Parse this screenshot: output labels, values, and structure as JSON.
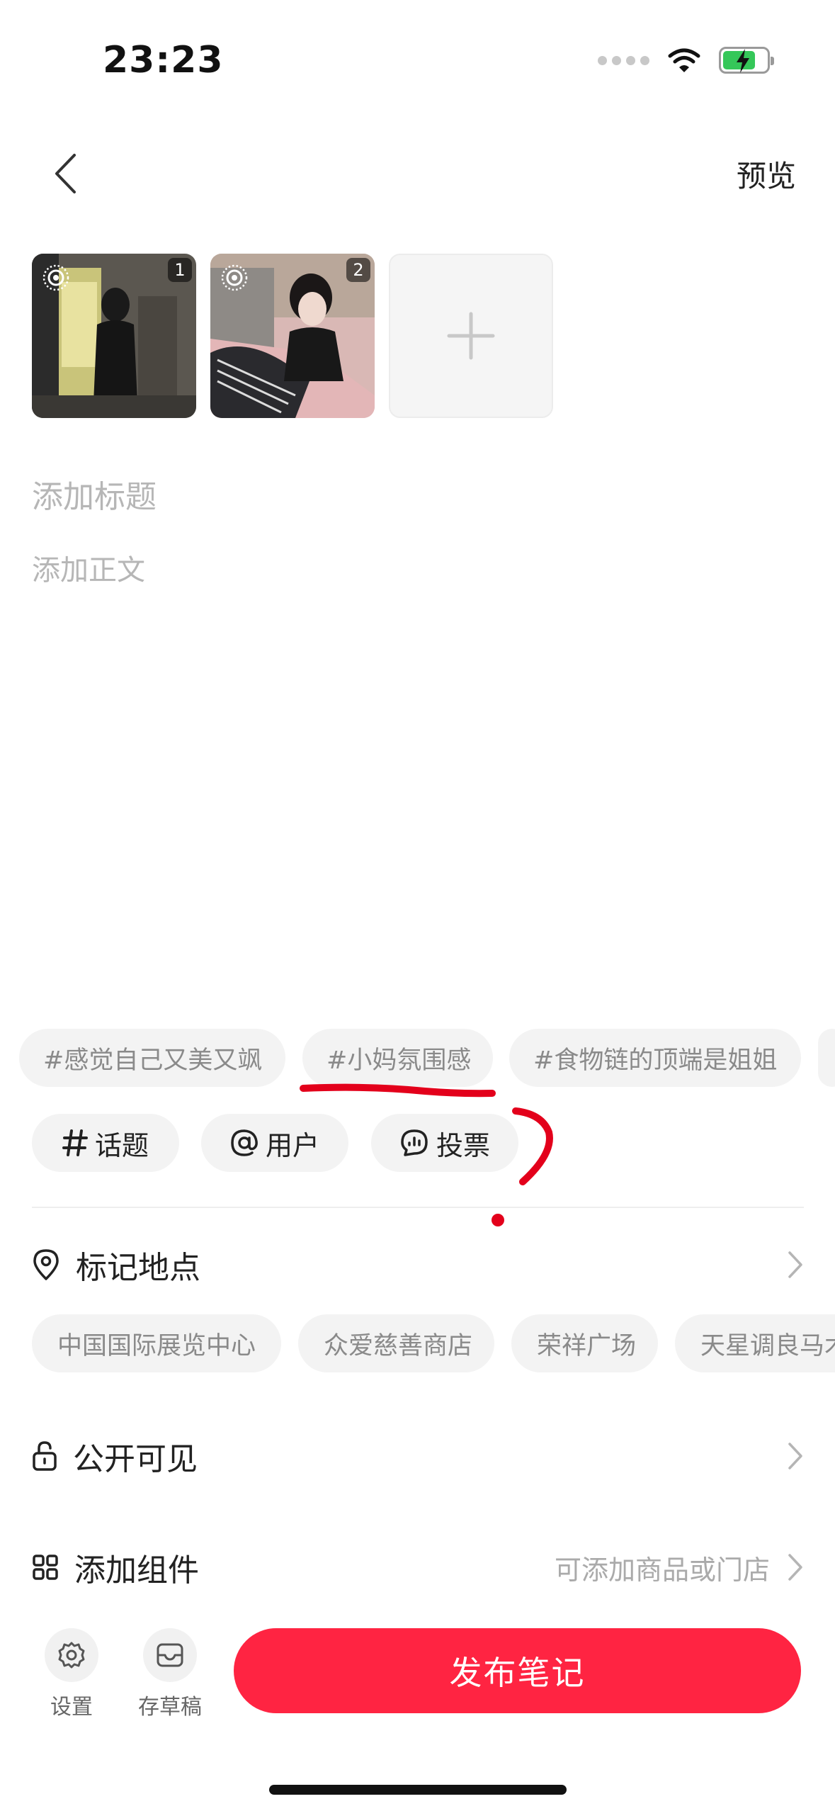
{
  "status_bar": {
    "time": "23:23"
  },
  "nav": {
    "preview_label": "预览"
  },
  "media": {
    "thumbnails": [
      {
        "index": "1"
      },
      {
        "index": "2"
      }
    ]
  },
  "editor": {
    "title_placeholder": "添加标题",
    "body_placeholder": "添加正文"
  },
  "suggested_tags": [
    "#感觉自己又美又飒",
    "#小妈氛围感",
    "#食物链的顶端是姐姐"
  ],
  "tools": {
    "topic_label": "话题",
    "user_label": "用户",
    "vote_label": "投票"
  },
  "location": {
    "label": "标记地点",
    "suggestions": [
      "中国国际展览中心",
      "众爱慈善商店",
      "荣祥广场",
      "天星调良马术"
    ]
  },
  "visibility": {
    "label": "公开可见"
  },
  "components": {
    "label": "添加组件",
    "hint": "可添加商品或门店"
  },
  "bottom_bar": {
    "settings_label": "设置",
    "drafts_label": "存草稿",
    "publish_label": "发布笔记"
  },
  "colors": {
    "brand_red": "#ff2442",
    "annotation_red": "#e3001b",
    "placeholder": "#b6b6b6",
    "chip_bg": "#f3f3f3"
  }
}
